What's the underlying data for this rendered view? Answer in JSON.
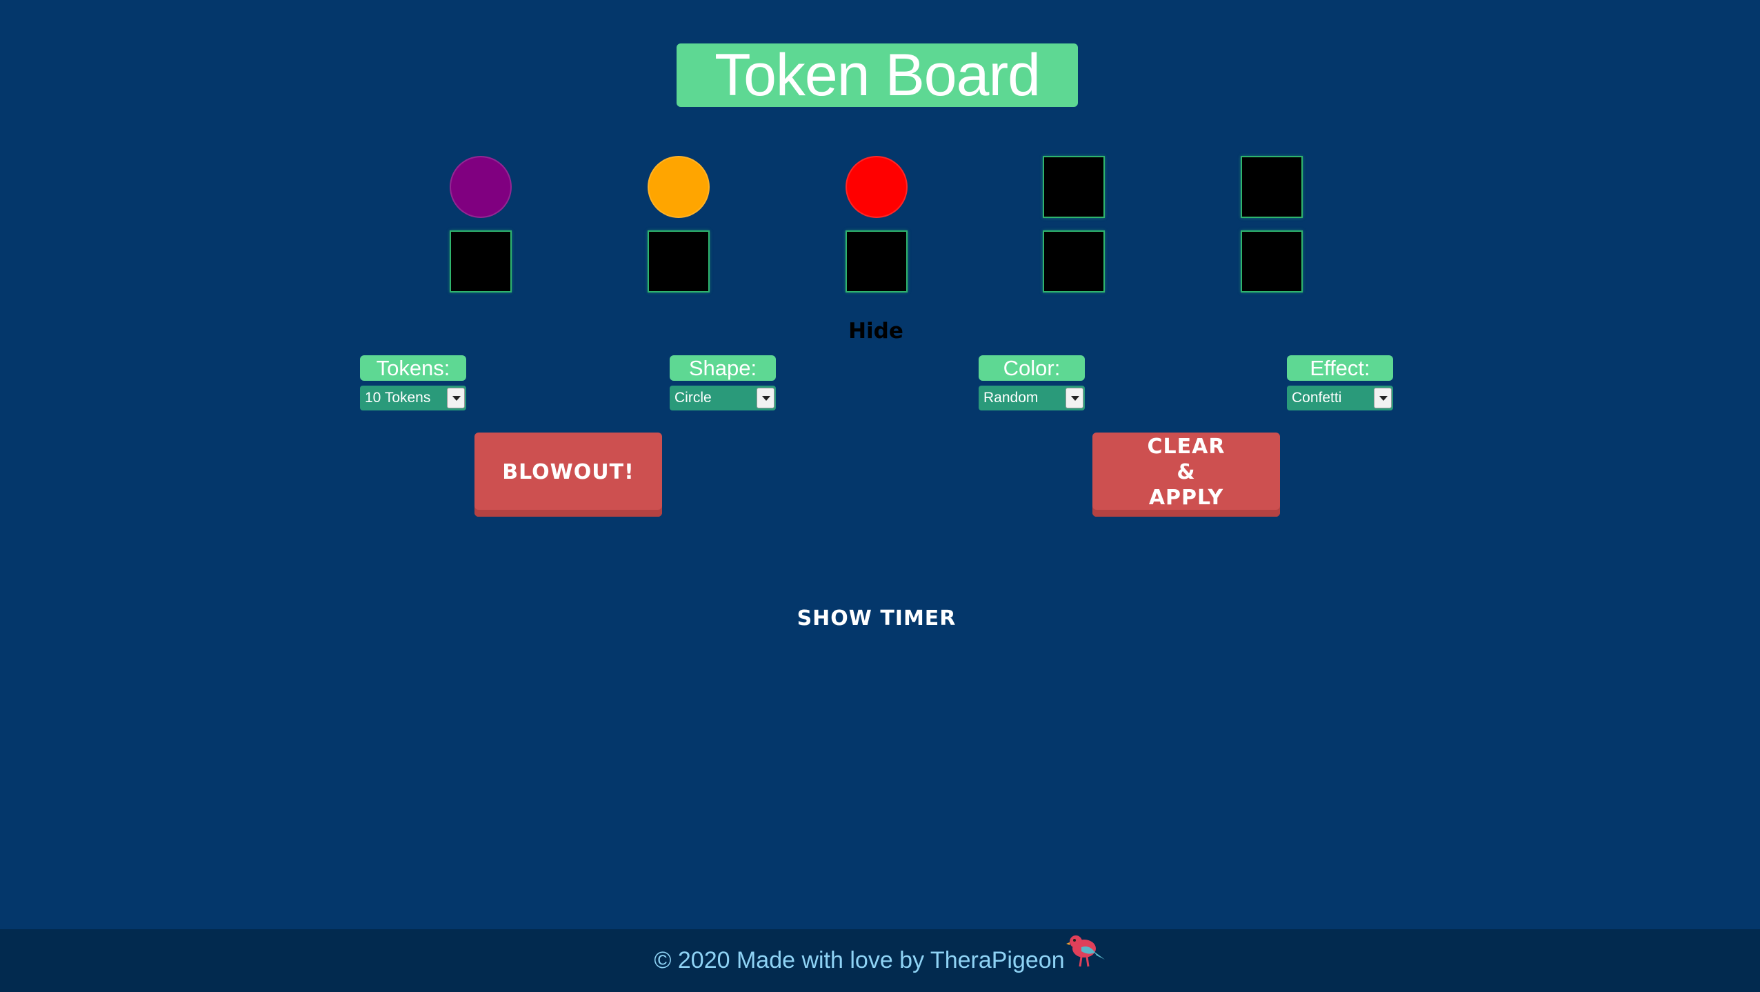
{
  "header": {
    "title": "Token Board"
  },
  "tokens": {
    "top_row": [
      {
        "shape": "circle",
        "color": "#800080",
        "filled": true
      },
      {
        "shape": "circle",
        "color": "#ffa500",
        "filled": true
      },
      {
        "shape": "circle",
        "color": "#ff0000",
        "filled": true
      },
      {
        "shape": "square",
        "color": "#000000",
        "filled": false
      },
      {
        "shape": "square",
        "color": "#000000",
        "filled": false
      }
    ],
    "bottom_row": [
      {
        "shape": "square",
        "color": "#000000",
        "filled": false
      },
      {
        "shape": "square",
        "color": "#000000",
        "filled": false
      },
      {
        "shape": "square",
        "color": "#000000",
        "filled": false
      },
      {
        "shape": "square",
        "color": "#000000",
        "filled": false
      },
      {
        "shape": "square",
        "color": "#000000",
        "filled": false
      }
    ]
  },
  "hide_label": "Hide",
  "controls": {
    "tokens": {
      "label": "Tokens:",
      "value": "10 Tokens"
    },
    "shape": {
      "label": "Shape:",
      "value": "Circle"
    },
    "color": {
      "label": "Color:",
      "value": "Random"
    },
    "effect": {
      "label": "Effect:",
      "value": "Confetti"
    }
  },
  "buttons": {
    "blowout": "BLOWOUT!",
    "clear_apply": "CLEAR\n&\nAPPLY"
  },
  "show_timer": "SHOW TIMER",
  "footer": {
    "text": "© 2020 Made with love by TheraPigeon",
    "icon": "pigeon-icon"
  },
  "colors": {
    "background": "#04376b",
    "accent_green": "#5ed893",
    "button_red": "#cd5050",
    "footer_bg": "#022a4f",
    "footer_text": "#8fd3f5"
  }
}
